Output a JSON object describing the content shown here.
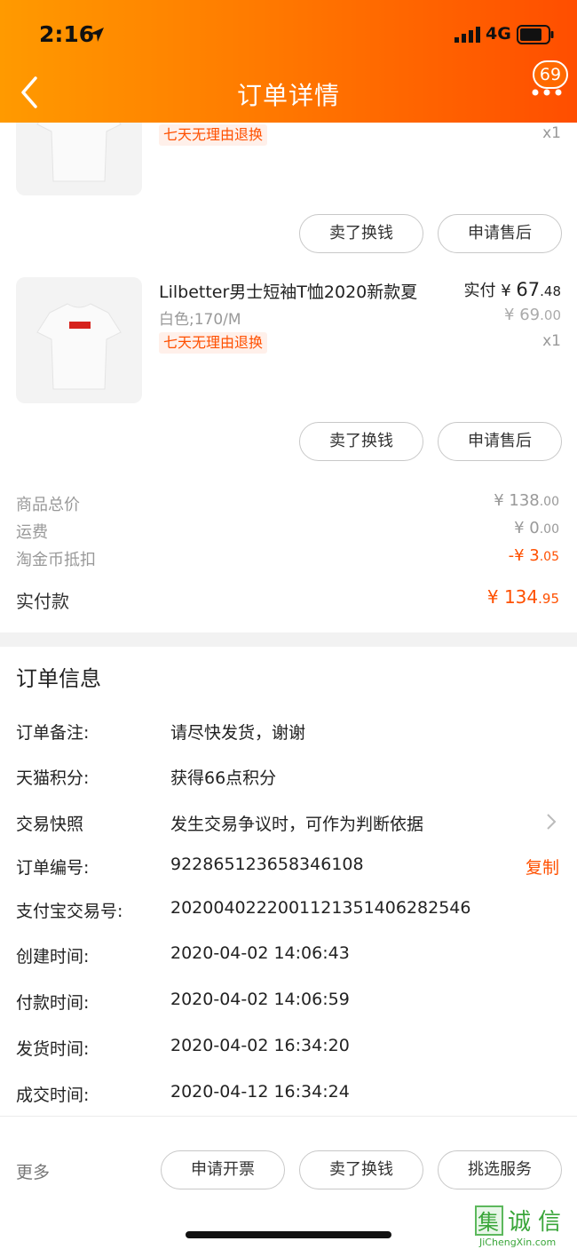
{
  "status": {
    "time": "2:16",
    "network": "4G"
  },
  "header": {
    "title": "订单详情",
    "badge_count": "69"
  },
  "product1": {
    "tag": "七天无理由退换",
    "qty": "x1",
    "btn_sell": "卖了换钱",
    "btn_after_sale": "申请售后"
  },
  "product2": {
    "title": "Lilbetter男士短袖T恤2020新款夏",
    "spec": "白色;170/M",
    "tag": "七天无理由退换",
    "paid_label": "实付",
    "paid_currency": "¥",
    "paid_int": "67",
    "paid_dec": ".48",
    "orig_currency": "¥",
    "orig_int": "69",
    "orig_dec": ".00",
    "qty": "x1",
    "btn_sell": "卖了换钱",
    "btn_after_sale": "申请售后"
  },
  "summary": {
    "goods_total_label": "商品总价",
    "goods_total_int": "¥ 138",
    "goods_total_dec": ".00",
    "shipping_label": "运费",
    "shipping_int": "¥ 0",
    "shipping_dec": ".00",
    "coin_label": "淘金币抵扣",
    "coin_int": "-¥ 3",
    "coin_dec": ".05",
    "paid_label": "实付款",
    "paid_int": "¥ 134",
    "paid_dec": ".95"
  },
  "order_info": {
    "title": "订单信息",
    "rows": [
      {
        "label": "订单备注:",
        "value": "请尽快发货，谢谢"
      },
      {
        "label": "天猫积分:",
        "value": "获得66点积分"
      },
      {
        "label": "交易快照",
        "value": "发生交易争议时，可作为判断依据"
      },
      {
        "label": "订单编号:",
        "value": "922865123658346108"
      },
      {
        "label": "支付宝交易号:",
        "value": "2020040222001121351406282546"
      },
      {
        "label": "创建时间:",
        "value": "2020-04-02 14:06:43"
      },
      {
        "label": "付款时间:",
        "value": "2020-04-02 14:06:59"
      },
      {
        "label": "发货时间:",
        "value": "2020-04-02 16:34:20"
      },
      {
        "label": "成交时间:",
        "value": "2020-04-12 16:34:24"
      }
    ],
    "copy_label": "复制"
  },
  "bottom": {
    "more": "更多",
    "btn_invoice": "申请开票",
    "btn_sell": "卖了换钱",
    "btn_services": "挑选服务"
  },
  "watermark": {
    "text": "JiChengXin.com",
    "chars": "集诚信"
  },
  "colors": {
    "accent": "#ff5000",
    "header_start": "#ff9a00",
    "header_end": "#ff4e00"
  }
}
